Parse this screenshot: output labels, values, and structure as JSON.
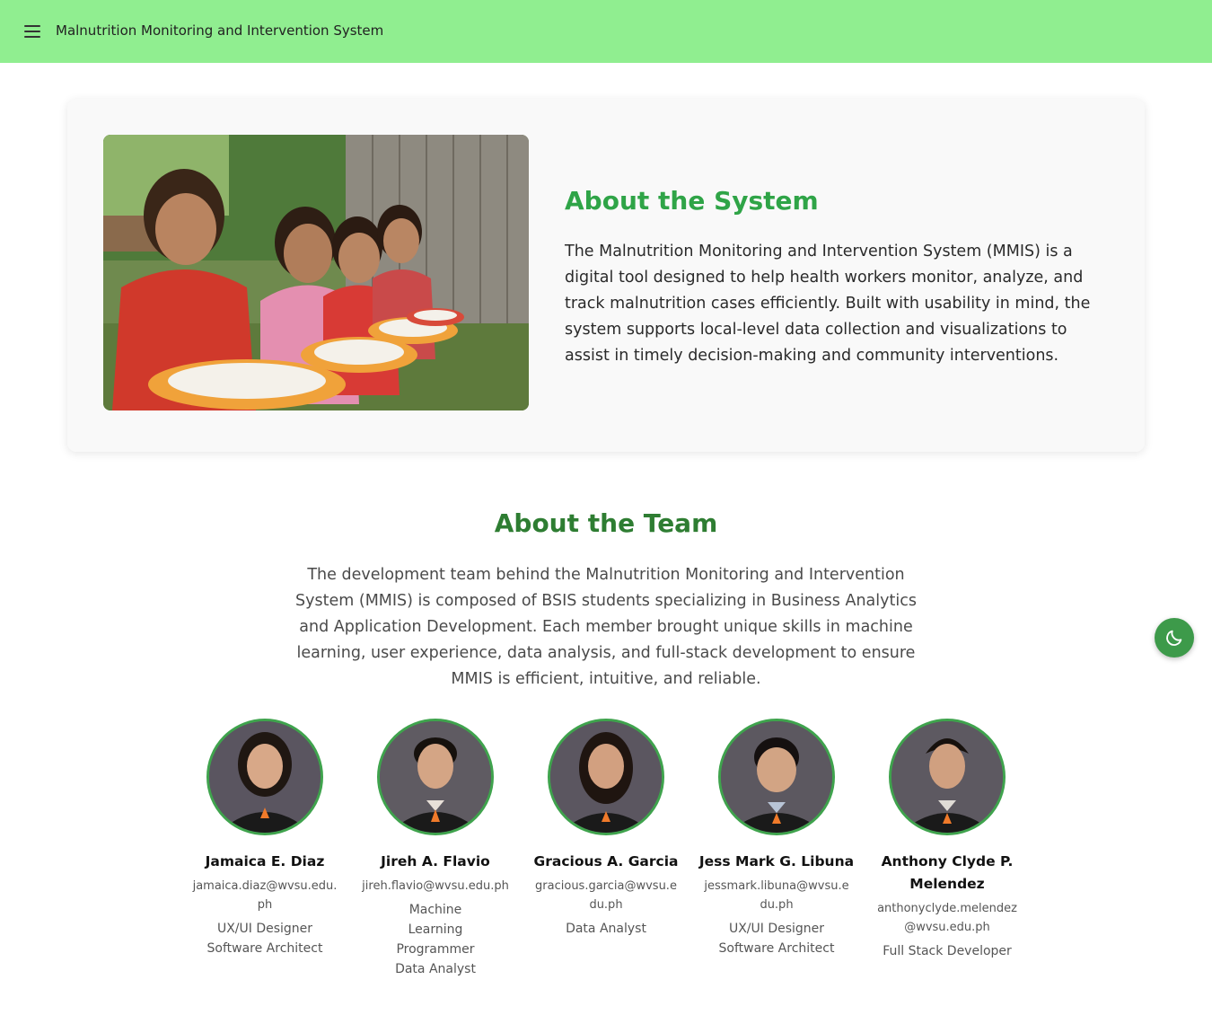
{
  "header": {
    "title": "Malnutrition Monitoring and Intervention System"
  },
  "system": {
    "title": "About the System",
    "description": "The Malnutrition Monitoring and Intervention System (MMIS) is a digital tool designed to help health workers monitor, analyze, and track malnutrition cases efficiently. Built with usability in mind, the system supports local-level data collection and visualizations to assist in timely decision-making and community interventions."
  },
  "team": {
    "title": "About the Team",
    "description": "The development team behind the Malnutrition Monitoring and Intervention System (MMIS) is composed of BSIS students specializing in Business Analytics and Application Development. Each member brought unique skills in machine learning, user experience, data analysis, and full-stack development to ensure MMIS is efficient, intuitive, and reliable.",
    "members": [
      {
        "name": "Jamaica E. Diaz",
        "email": "jamaica.diaz@wvsu.edu.ph",
        "roles": [
          "UX/UI Designer",
          "Software Architect"
        ]
      },
      {
        "name": "Jireh A. Flavio",
        "email": "jireh.flavio@wvsu.edu.ph",
        "roles": [
          "Machine Learning Programmer",
          "Data Analyst"
        ]
      },
      {
        "name": "Gracious A. Garcia",
        "email": "gracious.garcia@wvsu.edu.ph",
        "roles": [
          "Data Analyst"
        ]
      },
      {
        "name": "Jess Mark G. Libuna",
        "email": "jessmark.libuna@wvsu.edu.ph",
        "roles": [
          "UX/UI Designer",
          "Software Architect"
        ]
      },
      {
        "name": "Anthony Clyde P. Melendez",
        "email": "anthonyclyde.melendez@wvsu.edu.ph",
        "roles": [
          "Full Stack Developer"
        ]
      }
    ]
  },
  "icons": {
    "menu": "hamburger-menu-icon",
    "theme_toggle": "moon-icon"
  },
  "colors": {
    "header_bg": "#90ee90",
    "accent": "#2fa447",
    "team_heading": "#2e7d32",
    "toggle_bg": "#3d9a4a"
  }
}
